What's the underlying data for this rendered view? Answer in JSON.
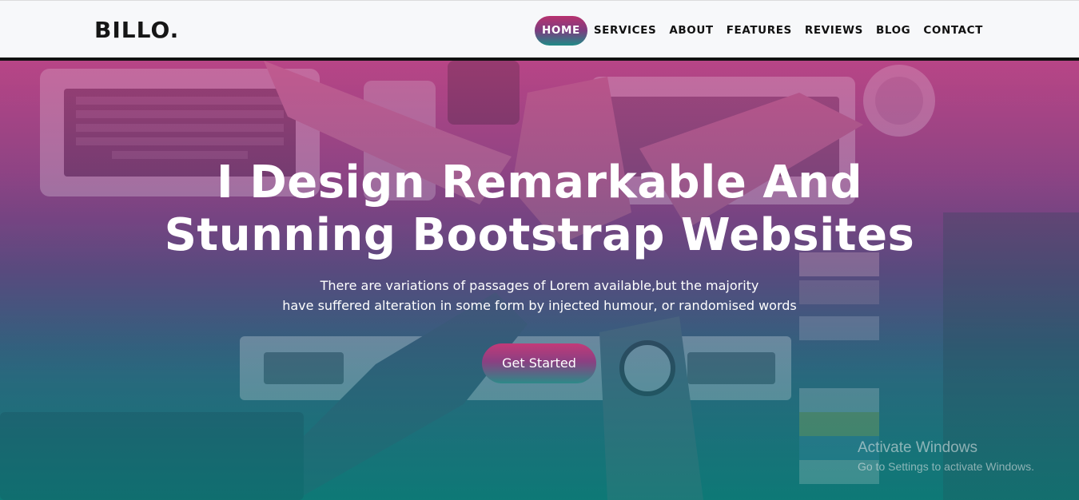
{
  "brand": "BILLO.",
  "nav": {
    "items": [
      {
        "label": "HOME",
        "active": true
      },
      {
        "label": "SERVICES",
        "active": false
      },
      {
        "label": "ABOUT",
        "active": false
      },
      {
        "label": "FEATURES",
        "active": false
      },
      {
        "label": "REVIEWS",
        "active": false
      },
      {
        "label": "BLOG",
        "active": false
      },
      {
        "label": "CONTACT",
        "active": false
      }
    ]
  },
  "hero": {
    "title_line1": "I Design Remarkable And",
    "title_line2": "Stunning Bootstrap Websites",
    "subtitle_line1": "There are variations of passages of Lorem available,but the majority",
    "subtitle_line2": "have suffered alteration in some form by injected humour, or randomised words",
    "cta_label": "Get Started"
  },
  "watermark": {
    "title": "Activate Windows",
    "subtitle": "Go to Settings to activate Windows."
  },
  "colors": {
    "accent_pink": "#c23a78",
    "accent_teal": "#1f8b86",
    "nav_bg": "#f7f8fa",
    "text_dark": "#111111"
  }
}
